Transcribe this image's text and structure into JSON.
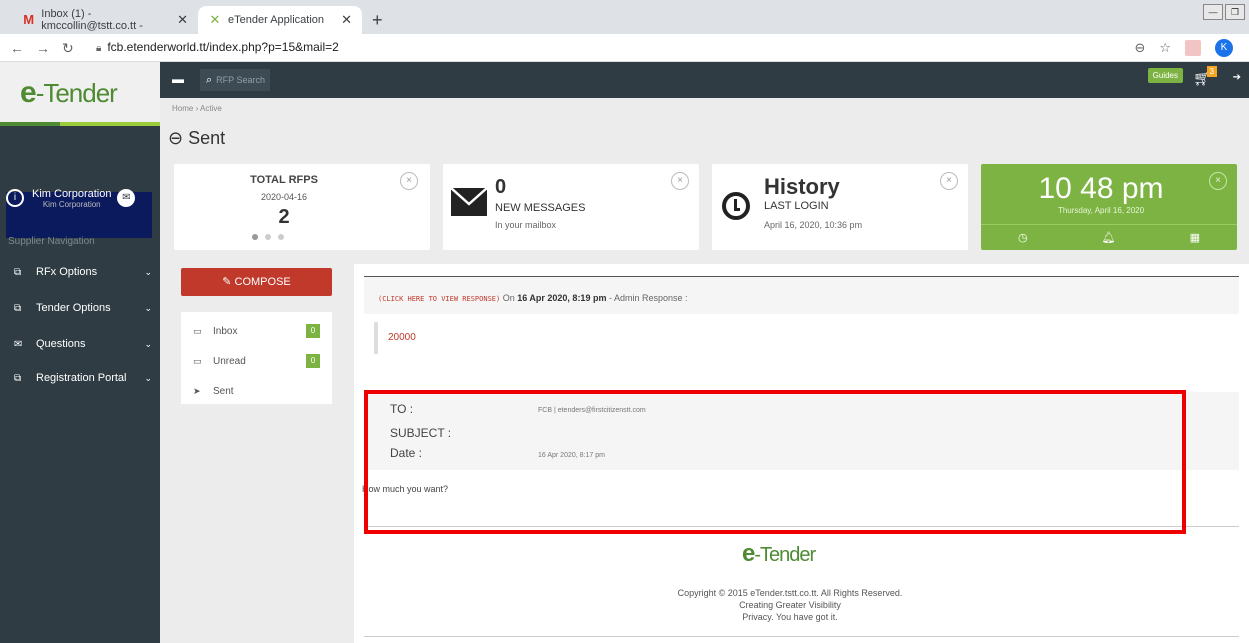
{
  "browser": {
    "tabs": [
      {
        "label": "Inbox (1) - kmccollin@tstt.co.tt -",
        "icon": "gmail-icon"
      },
      {
        "label": "eTender Application",
        "icon": "etender-icon"
      }
    ],
    "url": "fcb.etenderworld.tt/index.php?p=15&mail=2",
    "profile_initial": "K"
  },
  "app": {
    "logo_text": "-Tender",
    "logo_e": "e",
    "search_placeholder": "RFP Search",
    "guides_label": "Guides",
    "cart_count": "3",
    "breadcrumb": "Home  ›  Active",
    "page_title": "Sent"
  },
  "sidebar": {
    "user_name": "Kim Corporation",
    "user_sub": "Kim Corporation",
    "section_label": "Supplier Navigation",
    "items": [
      {
        "label": "RFx Options",
        "icon": "copy-icon"
      },
      {
        "label": "Tender Options",
        "icon": "copy-icon"
      },
      {
        "label": "Questions",
        "icon": "envelope-icon"
      },
      {
        "label": "Registration Portal",
        "icon": "copy-icon"
      }
    ]
  },
  "cards": {
    "rfps": {
      "title": "TOTAL RFPS",
      "date": "2020-04-16",
      "value": "2"
    },
    "messages": {
      "value": "0",
      "label": "NEW MESSAGES",
      "sub": "In your mailbox"
    },
    "history": {
      "title": "History",
      "label": "LAST LOGIN",
      "sub": "April 16, 2020, 10:36 pm"
    },
    "clock": {
      "time": "10 48 pm",
      "date": "Thursday, April 16, 2020"
    }
  },
  "mailbox": {
    "compose_label": "COMPOSE",
    "items": [
      {
        "label": "Inbox",
        "count": "0",
        "icon": "inbox-icon"
      },
      {
        "label": "Unread",
        "count": "0",
        "icon": "inbox-icon"
      },
      {
        "label": "Sent",
        "icon": "send-icon"
      }
    ]
  },
  "message": {
    "view_response": "(CLICK HERE TO VIEW RESPONSE)",
    "header_prefix": " On ",
    "header_date": "16 Apr 2020, 8:19 pm",
    "header_suffix": " - Admin Response :",
    "response_text": "20000",
    "to_label": "TO :",
    "to_value": "FCB | etenders@firstcitizenstt.com",
    "subject_label": "SUBJECT :",
    "date_label": "Date :",
    "date_value": "16 Apr 2020, 8:17 pm",
    "body": "How much you want?"
  },
  "footer": {
    "copyright": "Copyright © 2015 eTender.tstt.co.tt. All Rights Reserved.",
    "tagline": "Creating Greater Visibility",
    "privacy": "Privacy. You have got it."
  },
  "colors": {
    "brand_green": "#4e8b33",
    "accent_green": "#7cb342",
    "sidebar": "#2f3c43",
    "compose_red": "#c0392b",
    "highlight_red": "#ee0000"
  }
}
